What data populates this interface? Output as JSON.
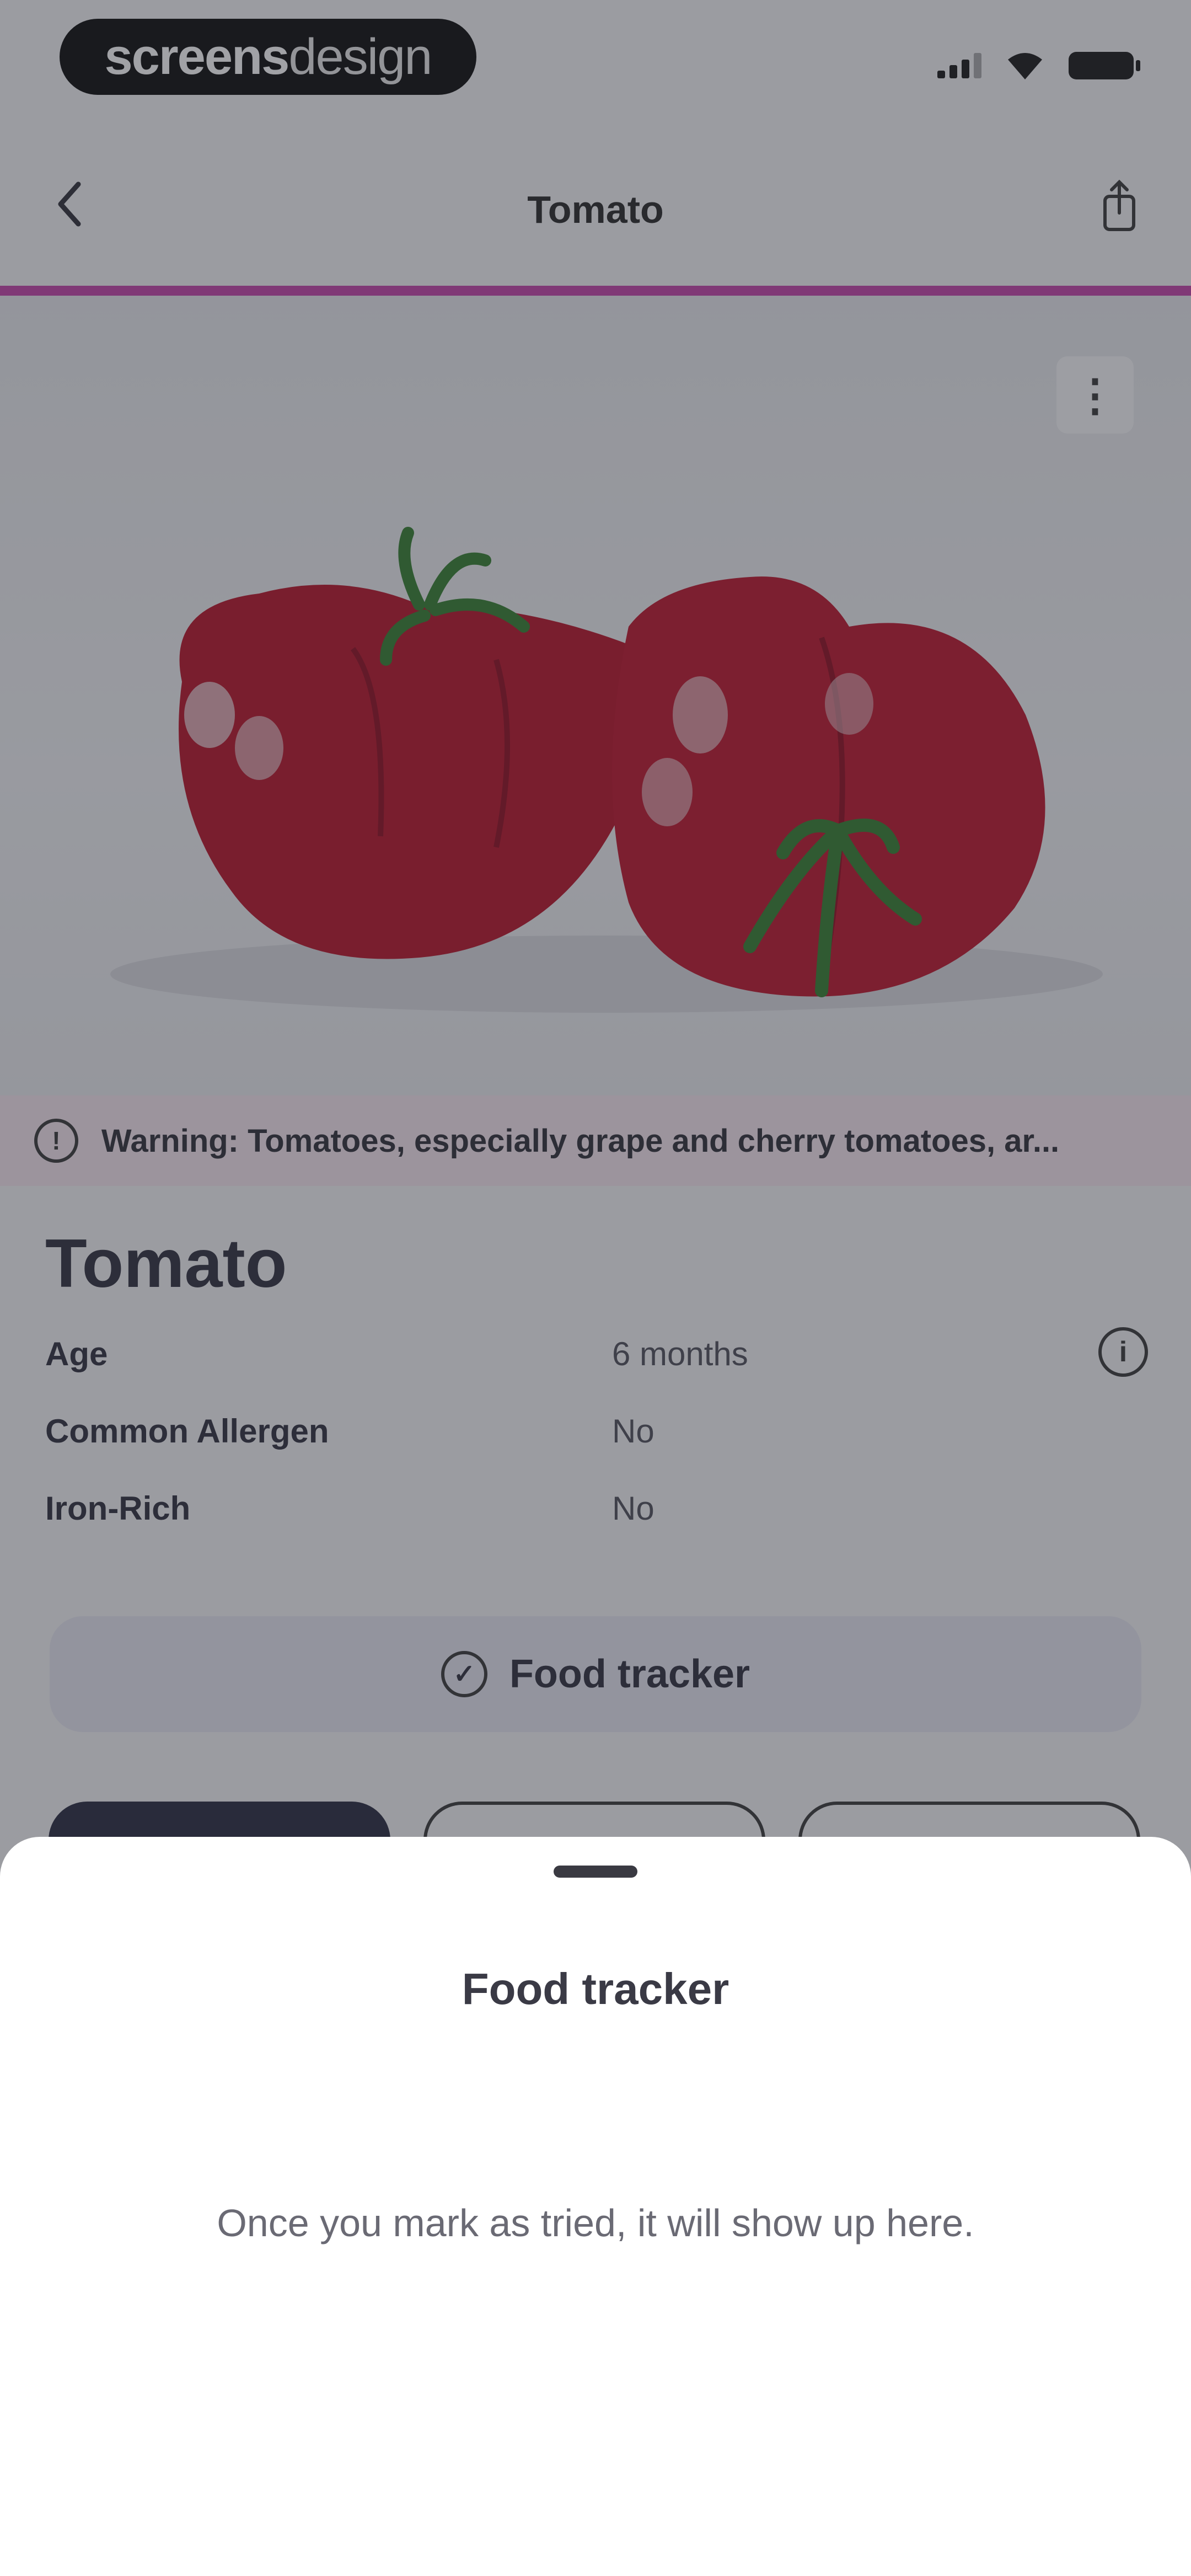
{
  "status_bar": {
    "brand_bold": "screens",
    "brand_light": "design"
  },
  "nav": {
    "title": "Tomato",
    "back_icon": "chevron-left-icon",
    "share_icon": "share-icon"
  },
  "hero": {
    "image": "tomato-photo",
    "more_icon": "more-vertical-icon"
  },
  "warning": {
    "icon": "info-icon",
    "text": "Warning: Tomatoes, especially grape and cherry tomatoes, ar..."
  },
  "food": {
    "name": "Tomato",
    "attributes": [
      {
        "label": "Age",
        "value": "6 months"
      },
      {
        "label": "Common Allergen",
        "value": "No"
      },
      {
        "label": "Iron-Rich",
        "value": "No"
      }
    ]
  },
  "tracker_button": {
    "label": "Food tracker",
    "icon": "check-circle-icon"
  },
  "sheet": {
    "title": "Food tracker",
    "message": "Once you mark as tried, it will show up here."
  },
  "colors": {
    "accent": "#c23ea6",
    "tracker_bg": "#e5e6f1",
    "warning_bg": "#f6e6ee",
    "dark_tab": "#22233a"
  }
}
